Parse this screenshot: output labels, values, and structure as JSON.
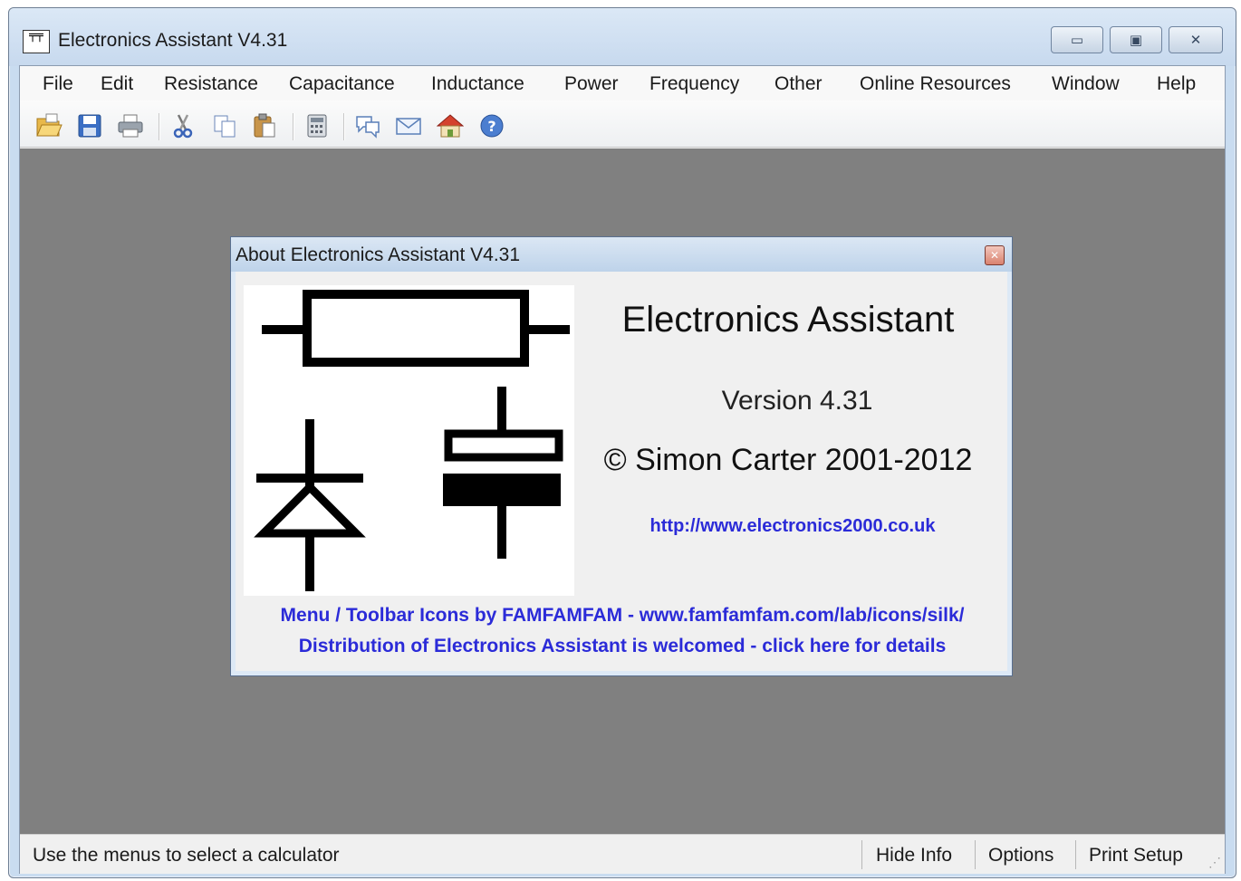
{
  "window": {
    "title": "Electronics Assistant V4.31",
    "app_icon_glyph": "╤╤",
    "minimize_glyph": "▭",
    "maximize_glyph": "▣",
    "close_glyph": "✕"
  },
  "menu": {
    "items": [
      "File",
      "Edit",
      "Resistance",
      "Capacitance",
      "Inductance",
      "Power",
      "Frequency",
      "Other",
      "Online Resources",
      "Window",
      "Help"
    ]
  },
  "toolbar": {
    "icons": [
      "open-folder-icon",
      "save-disk-icon",
      "printer-icon",
      "cut-scissors-icon",
      "copy-icon",
      "paste-icon",
      "calculator-icon",
      "comment-bubble-icon",
      "email-envelope-icon",
      "home-icon",
      "help-icon"
    ]
  },
  "about": {
    "title": "About Electronics Assistant V4.31",
    "close_glyph": "✕",
    "app_name": "Electronics Assistant",
    "version": "Version 4.31",
    "copyright": "© Simon Carter 2001-2012",
    "url": "http://www.electronics2000.co.uk",
    "credit_line": "Menu / Toolbar Icons by FAMFAMFAM - www.famfamfam.com/lab/icons/silk/",
    "distribution_line": "Distribution of Electronics Assistant is welcomed - click here for details"
  },
  "status": {
    "text": "Use the menus to select a calculator",
    "hide_info": "Hide Info",
    "options": "Options",
    "print_setup": "Print Setup"
  },
  "colors": {
    "link": "#2b2bd8",
    "mdi_background": "#808080"
  }
}
